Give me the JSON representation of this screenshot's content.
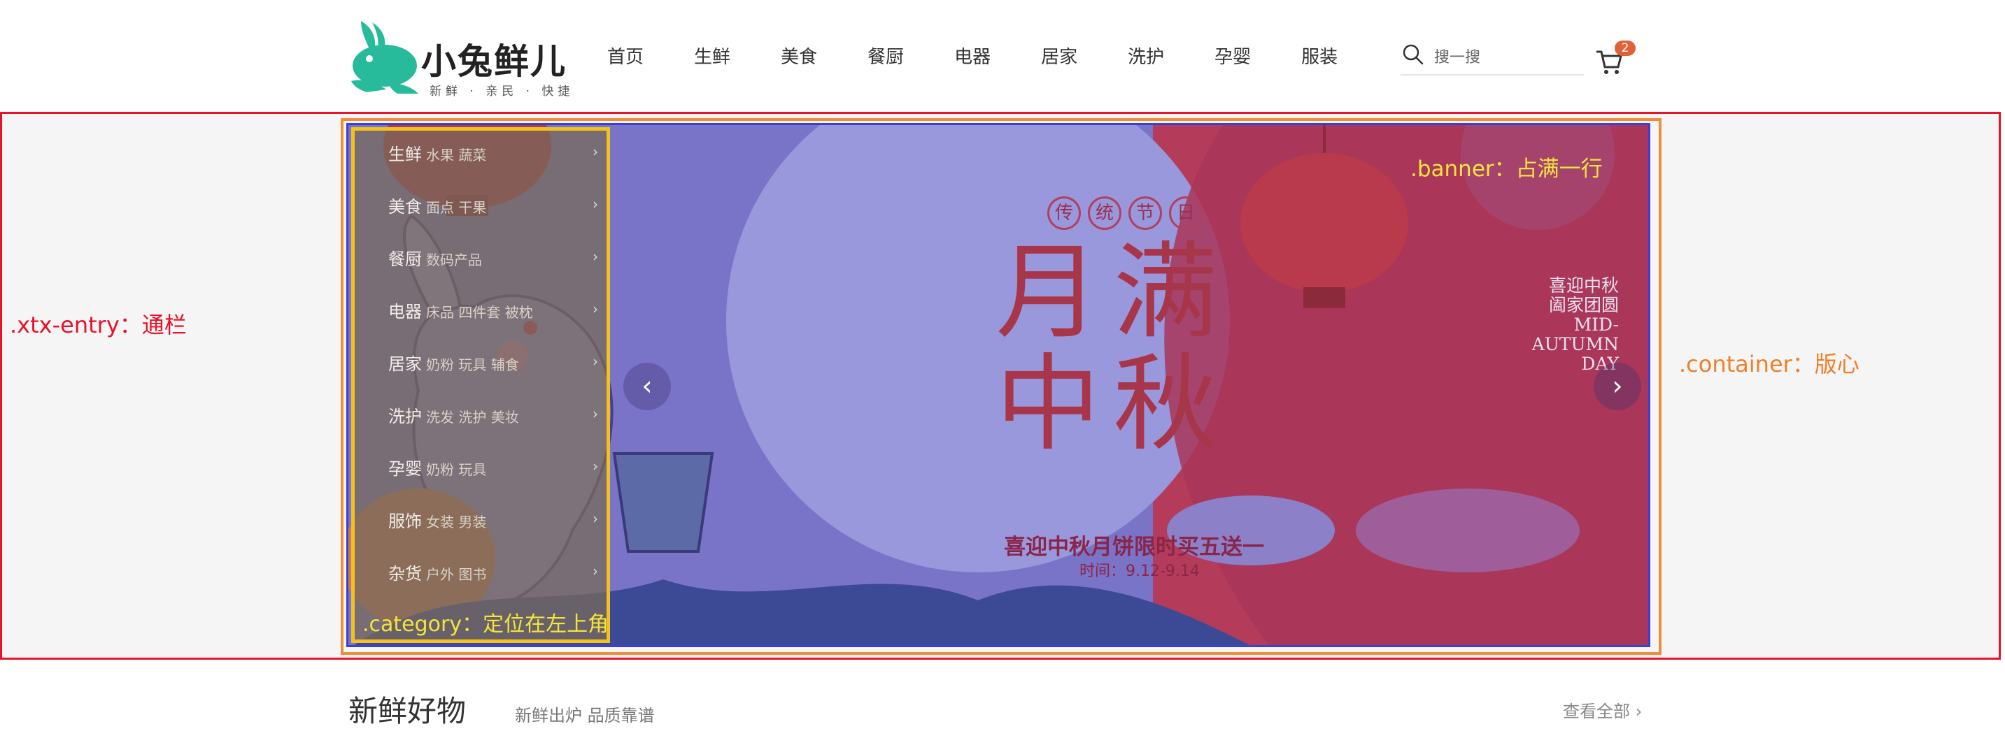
{
  "header": {
    "brand": "小兔鲜儿",
    "slogan": "新鲜 · 亲民 · 快捷",
    "nav": [
      "首页",
      "生鲜",
      "美食",
      "餐厨",
      "电器",
      "居家",
      "洗护",
      "孕婴",
      "服装"
    ],
    "search_placeholder": "搜一搜",
    "cart_count": "2",
    "logo_color": "#27ba9b"
  },
  "annotations": {
    "entry": ".xtx-entry：通栏",
    "container": ".container：版心",
    "banner": ".banner：占满一行",
    "category": ".category：定位在左上角",
    "entry_color": "#e8122a",
    "container_color": "#f07f2a",
    "banner_color": "#f4e53a"
  },
  "banner": {
    "tag_chars": [
      "传",
      "统",
      "节",
      "日"
    ],
    "title": "月满中秋",
    "subtitle": "喜迎中秋月饼限时买五送一",
    "date": "时间：9.12-9.14",
    "side_text": "喜迎中秋\n阖家团圆\nMID-\nAUTUMN\nDAY",
    "prev": "‹",
    "next": "›"
  },
  "category": {
    "items": [
      {
        "name": "生鲜",
        "sub": "水果 蔬菜"
      },
      {
        "name": "美食",
        "sub": "面点 干果"
      },
      {
        "name": "餐厨",
        "sub": "数码产品"
      },
      {
        "name": "电器",
        "sub": "床品 四件套 被枕"
      },
      {
        "name": "居家",
        "sub": "奶粉 玩具 辅食"
      },
      {
        "name": "洗护",
        "sub": "洗发 洗护 美妆"
      },
      {
        "name": "孕婴",
        "sub": "奶粉 玩具"
      },
      {
        "name": "服饰",
        "sub": "女装 男装"
      },
      {
        "name": "杂货",
        "sub": "户外 图书"
      }
    ]
  },
  "section": {
    "title": "新鲜好物",
    "subtitle": "新鲜出炉 品质靠谱",
    "view_all": "查看全部 ›"
  }
}
